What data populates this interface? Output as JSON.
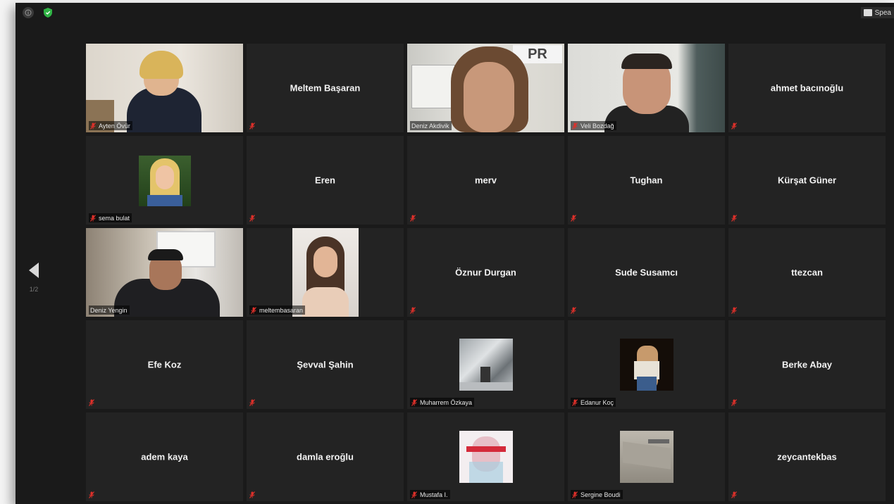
{
  "topbar": {
    "view_label": "Spea"
  },
  "pagination": {
    "page_indicator": "1/2"
  },
  "colors": {
    "active_speaker_border": "#c8d64a",
    "muted_icon": "#e0302a",
    "tile_bg": "#232323"
  },
  "participants": [
    {
      "name": "Ayten Övür",
      "kind": "video",
      "muted": true
    },
    {
      "name": "Meltem Başaran",
      "kind": "name",
      "muted": true
    },
    {
      "name": "Deniz Akdivik",
      "kind": "video",
      "muted": false
    },
    {
      "name": "Veli Bozdağ",
      "kind": "video",
      "muted": true
    },
    {
      "name": "ahmet bacınoğlu",
      "kind": "name",
      "muted": true
    },
    {
      "name": "sema bulat",
      "kind": "picture",
      "muted": true
    },
    {
      "name": "Eren",
      "kind": "name",
      "muted": true
    },
    {
      "name": "merv",
      "kind": "name",
      "muted": true
    },
    {
      "name": "Tughan",
      "kind": "name",
      "muted": true
    },
    {
      "name": "Kürşat Güner",
      "kind": "name",
      "muted": true
    },
    {
      "name": "Deniz Yengin",
      "kind": "video",
      "muted": false,
      "active": true
    },
    {
      "name": "meltembasaran",
      "kind": "picture",
      "muted": true
    },
    {
      "name": "Öznur Durgan",
      "kind": "name",
      "muted": true
    },
    {
      "name": "Sude Susamcı",
      "kind": "name",
      "muted": true
    },
    {
      "name": "ttezcan",
      "kind": "name",
      "muted": true
    },
    {
      "name": "Efe Koz",
      "kind": "name",
      "muted": true
    },
    {
      "name": "Şevval Şahin",
      "kind": "name",
      "muted": true
    },
    {
      "name": "Muharrem Özkaya",
      "kind": "picture",
      "muted": true
    },
    {
      "name": "Edanur Koç",
      "kind": "picture",
      "muted": true
    },
    {
      "name": "Berke Abay",
      "kind": "name",
      "muted": true
    },
    {
      "name": "adem kaya",
      "kind": "name",
      "muted": true
    },
    {
      "name": "damla eroğlu",
      "kind": "name",
      "muted": true
    },
    {
      "name": "Mustafa I.",
      "kind": "picture",
      "muted": true
    },
    {
      "name": "Sergine Boudi",
      "kind": "picture",
      "muted": true
    },
    {
      "name": "zeycantekbas",
      "kind": "name",
      "muted": true
    }
  ]
}
